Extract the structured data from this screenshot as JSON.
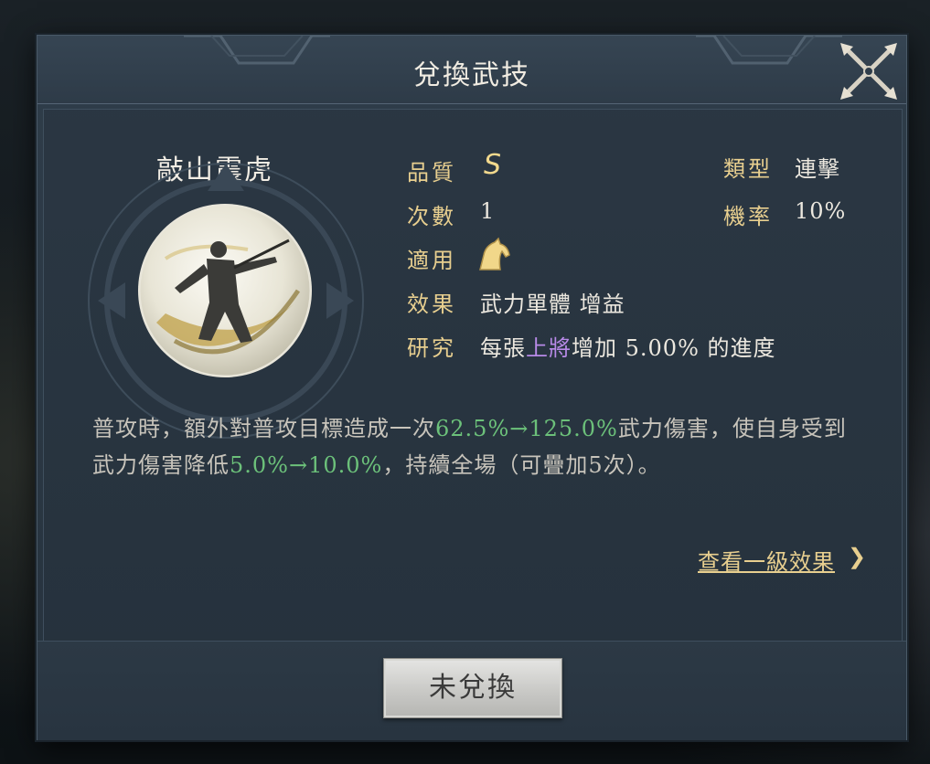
{
  "dialog": {
    "title": "兌換武技",
    "skill_name": "敲山震虎",
    "attributes": {
      "quality_label": "品質",
      "quality_value": "S",
      "type_label": "類型",
      "type_value": "連擊",
      "count_label": "次數",
      "count_value": "1",
      "chance_label": "機率",
      "chance_value": "10%",
      "applicable_label": "適用",
      "applicable_icon": "cavalry-horse-icon",
      "effect_label": "效果",
      "effect_value": "武力單體 增益",
      "research_label": "研究",
      "research_prefix": "每張",
      "research_highlight": "上將",
      "research_suffix": "增加 5.00% 的進度"
    },
    "description": {
      "part1": "普攻時，額外對普攻目標造成一次",
      "value1": "62.5%→125.0%",
      "part2": "武力傷害，使自身受到武力傷害降低",
      "value2": "5.0%→10.0%",
      "part3": "，持續全場（可疊加5次）。"
    },
    "view_level1_link": "查看一級效果",
    "view_level1_arrow": "❯",
    "exchange_button": "未兌換"
  },
  "colors": {
    "accent_gold": "#e8cf8f",
    "highlight_green": "#6cc17a",
    "highlight_purple": "#b88ae8"
  }
}
